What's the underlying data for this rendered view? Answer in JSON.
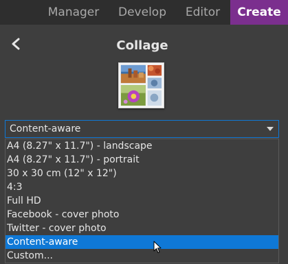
{
  "nav": {
    "tabs": [
      {
        "label": "Manager"
      },
      {
        "label": "Develop"
      },
      {
        "label": "Editor"
      },
      {
        "label": "Create"
      }
    ],
    "active_color": "#7b2f8e"
  },
  "panel": {
    "title": "Collage",
    "back_icon": "chevron-left-icon"
  },
  "select": {
    "value": "Content-aware",
    "accent_color": "#0f78d6"
  },
  "dropdown": {
    "options": [
      {
        "label": "A4 (8.27\" x 11.7\") - landscape"
      },
      {
        "label": "A4 (8.27\" x 11.7\") - portrait"
      },
      {
        "label": "30 x 30 cm (12\" x 12\")"
      },
      {
        "label": "4:3"
      },
      {
        "label": "Full HD"
      },
      {
        "label": "Facebook - cover photo"
      },
      {
        "label": "Twitter - cover photo"
      },
      {
        "label": "Content-aware"
      },
      {
        "label": "Custom..."
      }
    ],
    "selected": "Content-aware"
  }
}
